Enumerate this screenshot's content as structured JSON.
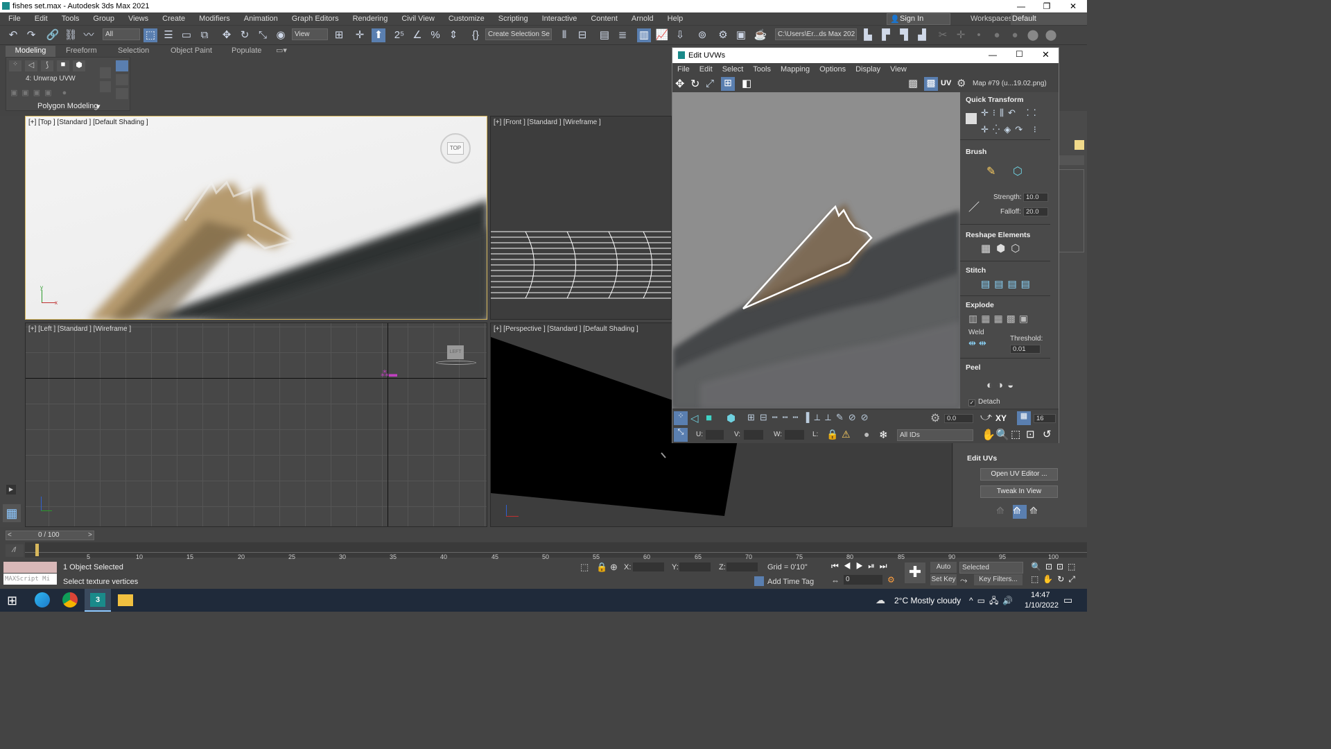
{
  "window": {
    "title": "fishes set.max - Autodesk 3ds Max 2021",
    "minimize": "—",
    "restore": "❐",
    "close": "✕"
  },
  "menu": [
    "File",
    "Edit",
    "Tools",
    "Group",
    "Views",
    "Create",
    "Modifiers",
    "Animation",
    "Graph Editors",
    "Rendering",
    "Civil View",
    "Customize",
    "Scripting",
    "Interactive",
    "Content",
    "Arnold",
    "Help"
  ],
  "account": {
    "sign_in": "Sign In",
    "workspaces_label": "Workspaces:",
    "workspace_value": "Default"
  },
  "toolbar": {
    "selection_filter": "All",
    "ref_coord": "View",
    "named_selection": "Create Selection Se",
    "path": "C:\\Users\\Er...ds Max 202"
  },
  "ribbon": {
    "tabs": [
      "Modeling",
      "Freeform",
      "Selection",
      "Object Paint",
      "Populate"
    ],
    "modifier_label": "4: Unwrap UVW",
    "panel_label": "Polygon Modeling"
  },
  "viewports": {
    "top": {
      "label": "[+] [Top ] [Standard ] [Default Shading ]",
      "cube": "TOP"
    },
    "front": {
      "label": "[+] [Front ] [Standard ] [Wireframe ]"
    },
    "left": {
      "label": "[+] [Left ] [Standard ] [Wireframe ]",
      "cube": "LEFT"
    },
    "perspective": {
      "label": "[+] [Perspective ] [Standard ] [Default Shading ]"
    }
  },
  "uvw": {
    "title": "Edit UVWs",
    "menu": [
      "File",
      "Edit",
      "Select",
      "Tools",
      "Mapping",
      "Options",
      "Display",
      "View"
    ],
    "uv_label": "UV",
    "map_dropdown": "Map #79 (u...19.02.png)",
    "sections": {
      "quick_transform": "Quick Transform",
      "brush": "Brush",
      "reshape": "Reshape Elements",
      "stitch": "Stitch",
      "explode": "Explode",
      "peel": "Peel"
    },
    "strength_label": "Strength:",
    "strength_value": "10.0",
    "falloff_label": "Falloff:",
    "falloff_value": "20.0",
    "weld_label": "Weld",
    "threshold_label": "Threshold:",
    "threshold_value": "0.01",
    "detach_label": "Detach",
    "rotate_value": "0.0",
    "xy_label": "XY",
    "grid_value": "16",
    "u_label": "U:",
    "v_label": "V:",
    "w_label": "W:",
    "l_label": "L:",
    "ids_dropdown": "All IDs"
  },
  "cmdpanel": {
    "edit_uvs_title": "Edit UVs",
    "open_uv_editor": "Open UV Editor ...",
    "tweak_in_view": "Tweak In View"
  },
  "timeline": {
    "frame": "0 / 100",
    "ticks": [
      "5",
      "10",
      "15",
      "20",
      "25",
      "30",
      "35",
      "40",
      "45",
      "50",
      "55",
      "60",
      "65",
      "70",
      "75",
      "80",
      "85",
      "90",
      "95",
      "100"
    ]
  },
  "status": {
    "maxscript": "MAXScript Mi",
    "selected": "1 Object Selected",
    "prompt": "Select texture vertices",
    "x_label": "X:",
    "y_label": "Y:",
    "z_label": "Z:",
    "grid": "Grid = 0'10\"",
    "add_time_tag": "Add Time Tag",
    "autokey": "Auto K...",
    "set_key": "Set Key",
    "selected_dropdown": "Selected",
    "key_filters": "Key Filters...",
    "frame_field": "0"
  },
  "taskbar": {
    "weather": "2°C  Mostly cloudy",
    "time": "14:47",
    "date": "1/10/2022"
  },
  "colors": {
    "accent": "#5a7fb0",
    "selection_outline": "#ffffff"
  }
}
